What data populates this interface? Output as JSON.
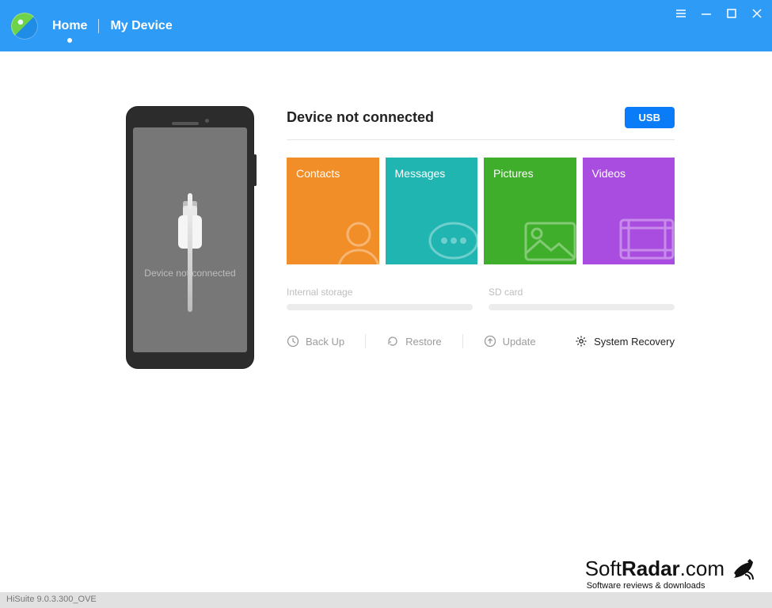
{
  "nav": {
    "home": "Home",
    "device": "My Device"
  },
  "main": {
    "heading": "Device not connected",
    "usb_btn": "USB",
    "phone_status": "Device not connected",
    "tiles": {
      "contacts": "Contacts",
      "messages": "Messages",
      "pictures": "Pictures",
      "videos": "Videos"
    },
    "storage": {
      "internal": "Internal storage",
      "sd": "SD card"
    },
    "actions": {
      "backup": "Back Up",
      "restore": "Restore",
      "update": "Update",
      "recovery": "System Recovery"
    }
  },
  "statusbar": "HiSuite 9.0.3.300_OVE",
  "watermark": {
    "brand_a": "Soft",
    "brand_b": "Radar",
    "brand_c": ".com",
    "tag": "Software reviews & downloads"
  }
}
